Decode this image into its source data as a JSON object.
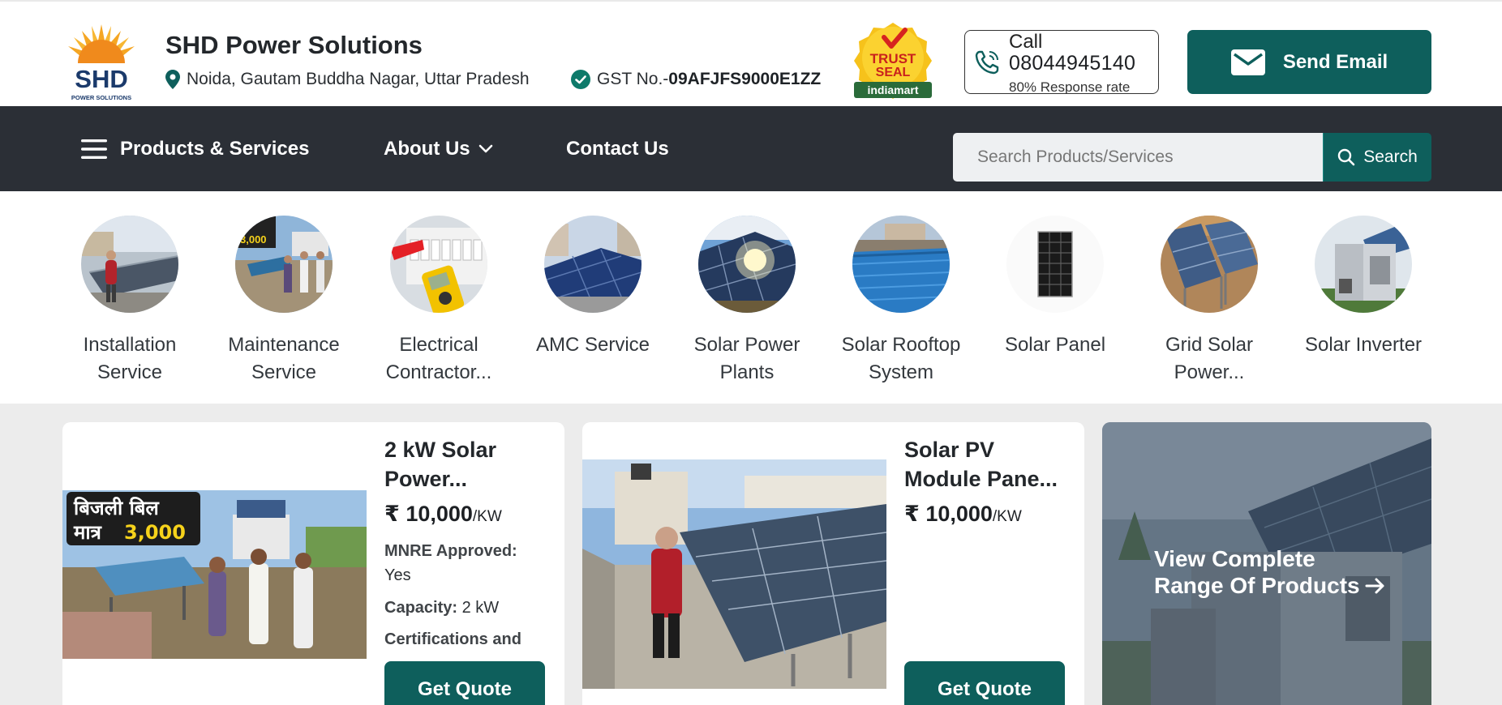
{
  "company": {
    "name": "SHD Power Solutions",
    "logo_text": "SHD",
    "logo_subtext": "POWER SOLUTIONS",
    "location": "Noida, Gautam Buddha Nagar, Uttar Pradesh",
    "gst_label": "GST No.-",
    "gst_number": "09AFJFS9000E1ZZ",
    "trust_seal_line1": "TRUST",
    "trust_seal_line2": "SEAL",
    "trust_seal_brand": "indiamart"
  },
  "call": {
    "label": "Call",
    "number": "08044945140",
    "response_rate": "80% Response rate"
  },
  "email_button": "Send Email",
  "nav": {
    "products": "Products & Services",
    "about": "About Us",
    "contact": "Contact Us"
  },
  "search": {
    "placeholder": "Search Products/Services",
    "button": "Search"
  },
  "categories": [
    {
      "label": "Installation Service"
    },
    {
      "label": "Maintenance Service"
    },
    {
      "label": "Electrical Contractor..."
    },
    {
      "label": "AMC Service"
    },
    {
      "label": "Solar Power Plants"
    },
    {
      "label": "Solar Rooftop System"
    },
    {
      "label": "Solar Panel"
    },
    {
      "label": "Grid Solar Power..."
    },
    {
      "label": "Solar Inverter"
    }
  ],
  "products": [
    {
      "title": "2 kW Solar Power...",
      "currency": "₹",
      "price": "10,000",
      "unit": "/KW",
      "image_text_line1": "बिजली बिल",
      "image_text_line2": "मात्र",
      "image_text_amount": "3,000",
      "spec1_label": "MNRE Approved:",
      "spec1_value": "Yes",
      "spec2_label": "Capacity:",
      "spec2_value": "2 kW",
      "spec3_label": "Certifications and",
      "button": "Get Quote"
    },
    {
      "title": "Solar PV Module Pane...",
      "currency": "₹",
      "price": "10,000",
      "unit": "/KW",
      "button": "Get Quote"
    }
  ],
  "view_range": {
    "line1": "View Complete",
    "line2": "Range Of Products"
  },
  "colors": {
    "brand_teal": "#0e5f5c",
    "nav_dark": "#2b2f36",
    "page_bg": "#ececec"
  }
}
